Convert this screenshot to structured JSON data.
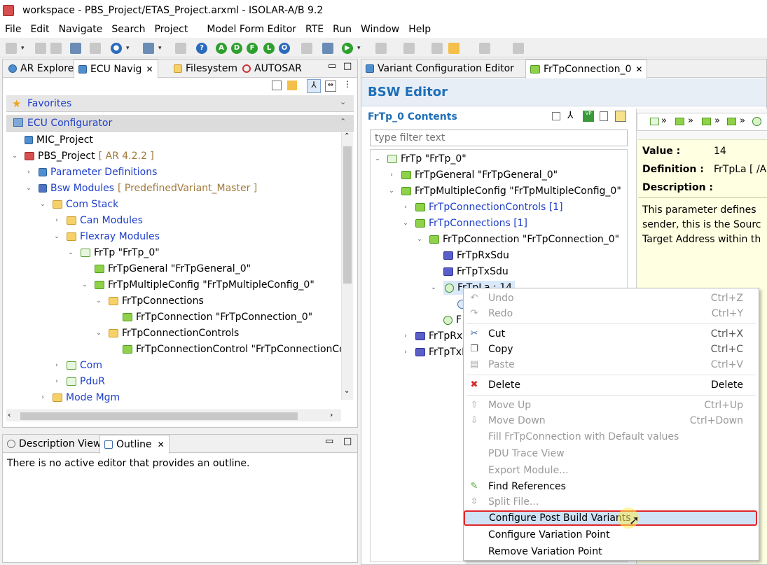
{
  "window": {
    "title": "workspace - PBS_Project/ETAS_Project.arxml - ISOLAR-A/B 9.2"
  },
  "menu": [
    "File",
    "Edit",
    "Navigate",
    "Search",
    "Project",
    "Model Form Editor",
    "RTE",
    "Run",
    "Window",
    "Help"
  ],
  "toolbar": {
    "icons": [
      "new-icon",
      "save-icon",
      "save-all-icon",
      "select-icon",
      "edit-icon",
      "target-icon",
      "run-config-icon",
      "search-icon",
      "help-icon",
      "A",
      "D",
      "F",
      "L",
      "O",
      "settings-icon",
      "R-icon",
      "run-icon",
      "nav-icon",
      "back-icon",
      "forward-icon",
      "pin-icon"
    ]
  },
  "left_tabs": [
    "AR Explore",
    "ECU Navig",
    "Filesystem",
    "AUTOSAR"
  ],
  "left_sections": {
    "favorites": "Favorites",
    "ecu_config": "ECU Configurator"
  },
  "left_tree": [
    {
      "label": "MIC_Project",
      "suffix": ""
    },
    {
      "label": "PBS_Project",
      "suffix": "[ AR 4.2.2 ]"
    },
    {
      "label": "Parameter Definitions",
      "suffix": ""
    },
    {
      "label": "Bsw Modules",
      "suffix": "[ PredefinedVariant_Master ]"
    },
    {
      "label": "Com Stack",
      "suffix": ""
    },
    {
      "label": "Can Modules",
      "suffix": ""
    },
    {
      "label": "Flexray Modules",
      "suffix": ""
    },
    {
      "label": "FrTp \"FrTp_0\"",
      "suffix": ""
    },
    {
      "label": "FrTpGeneral \"FrTpGeneral_0\"",
      "suffix": ""
    },
    {
      "label": "FrTpMultipleConfig \"FrTpMultipleConfig_0\"",
      "suffix": ""
    },
    {
      "label": "FrTpConnections",
      "suffix": ""
    },
    {
      "label": "FrTpConnection \"FrTpConnection_0\"",
      "suffix": ""
    },
    {
      "label": "FrTpConnectionControls",
      "suffix": ""
    },
    {
      "label": "FrTpConnectionControl \"FrTpConnectionCon",
      "suffix": ""
    },
    {
      "label": "Com",
      "suffix": ""
    },
    {
      "label": "PduR",
      "suffix": ""
    },
    {
      "label": "Mode Mgm",
      "suffix": ""
    }
  ],
  "bottom_tabs": [
    "Description View",
    "Outline"
  ],
  "outline_message": "There is no active editor that provides an outline.",
  "editor_tabs": [
    "Variant Configuration Editor",
    "FrTpConnection_0"
  ],
  "editor": {
    "title": "BSW Editor",
    "contents_title": "FrTp_0 Contents",
    "filter_placeholder": "type filter text",
    "tree": [
      "FrTp \"FrTp_0\"",
      "FrTpGeneral \"FrTpGeneral_0\"",
      "FrTpMultipleConfig \"FrTpMultipleConfig_0\"",
      "FrTpConnectionControls [1]",
      "FrTpConnections [1]",
      "FrTpConnection \"FrTpConnection_0\"",
      "FrTpRxSdu",
      "FrTpTxSdu",
      "FrTpLa : 14",
      "",
      "F",
      "FrTpRxl",
      "FrTpTxP"
    ],
    "details": {
      "value_label": "Value :",
      "value": "14",
      "definition_label": "Definition :",
      "definition": "FrTpLa [ /A",
      "description_label": "Description :",
      "desc_lines": [
        "This parameter defines",
        "sender, this is the Sourc",
        "Target Address within th"
      ]
    }
  },
  "context_menu": [
    {
      "label": "Undo",
      "shortcut": "Ctrl+Z",
      "enabled": false,
      "icon": "undo-icon"
    },
    {
      "label": "Redo",
      "shortcut": "Ctrl+Y",
      "enabled": false,
      "icon": "redo-icon"
    },
    {
      "label": "Cut",
      "shortcut": "Ctrl+X",
      "enabled": true,
      "icon": "cut-icon"
    },
    {
      "label": "Copy",
      "shortcut": "Ctrl+C",
      "enabled": true,
      "icon": "copy-icon"
    },
    {
      "label": "Paste",
      "shortcut": "Ctrl+V",
      "enabled": false,
      "icon": "paste-icon"
    },
    {
      "label": "Delete",
      "shortcut": "Delete",
      "enabled": true,
      "icon": "delete-icon"
    },
    {
      "label": "Move Up",
      "shortcut": "Ctrl+Up",
      "enabled": false,
      "icon": "move-up-icon"
    },
    {
      "label": "Move Down",
      "shortcut": "Ctrl+Down",
      "enabled": false,
      "icon": "move-down-icon"
    },
    {
      "label": "Fill FrTpConnection with Default values",
      "shortcut": "",
      "enabled": false,
      "icon": ""
    },
    {
      "label": "PDU Trace View",
      "shortcut": "",
      "enabled": false,
      "icon": ""
    },
    {
      "label": "Export Module...",
      "shortcut": "",
      "enabled": false,
      "icon": ""
    },
    {
      "label": "Find References",
      "shortcut": "",
      "enabled": true,
      "icon": "find-references-icon"
    },
    {
      "label": "Split File...",
      "shortcut": "",
      "enabled": false,
      "icon": "split-icon"
    },
    {
      "label": "Configure Post Build Variants",
      "shortcut": "",
      "enabled": true,
      "icon": "",
      "highlighted": true
    },
    {
      "label": "Configure Variation Point",
      "shortcut": "",
      "enabled": true,
      "icon": ""
    },
    {
      "label": "Remove Variation Point",
      "shortcut": "",
      "enabled": true,
      "icon": ""
    }
  ],
  "colors": {
    "accent_blue": "#1f3fc8",
    "highlight_red": "#e0262b",
    "editor_header": "#1f6fb8",
    "details_bg": "#ffffe1"
  }
}
